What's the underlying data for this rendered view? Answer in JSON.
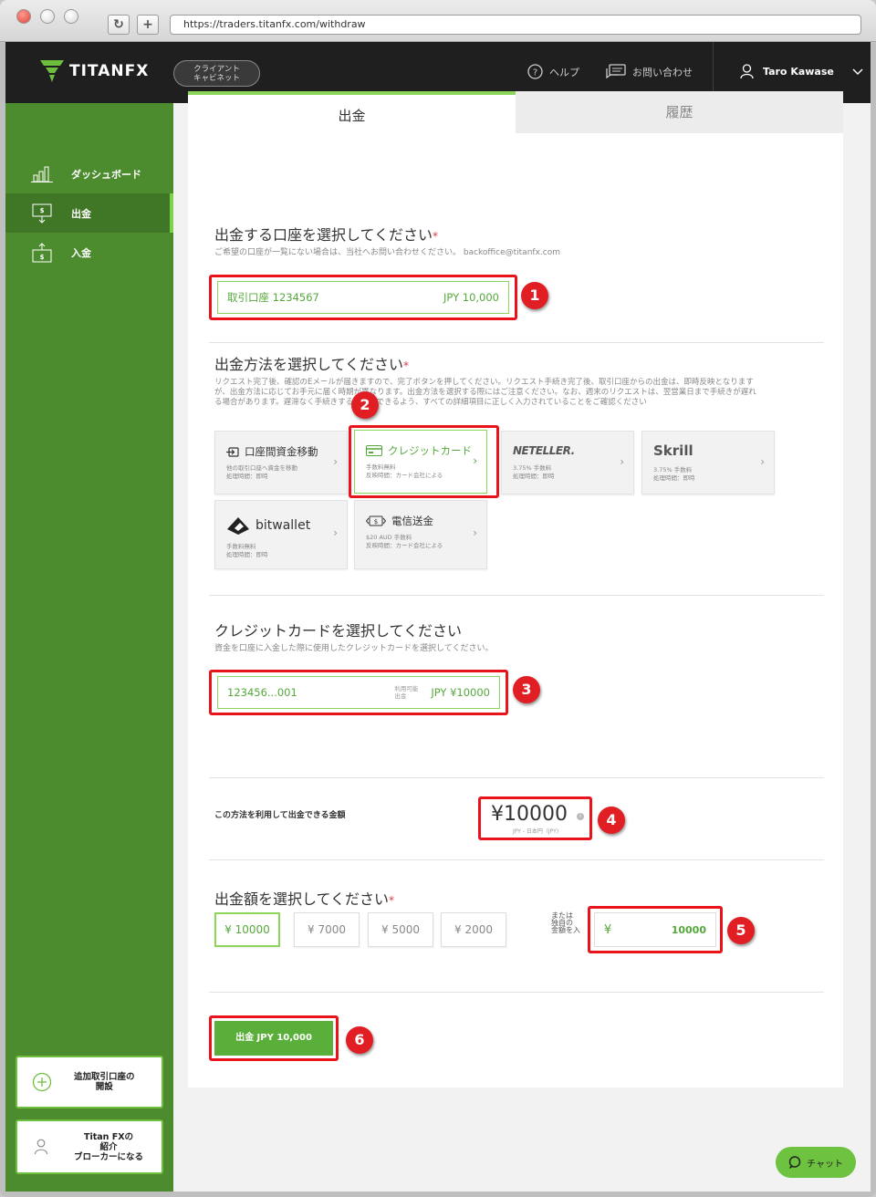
{
  "browser": {
    "url": "https://traders.titanfx.com/withdraw",
    "reload_icon": "reload-icon",
    "new_tab_label": "+"
  },
  "topbar": {
    "logo_text": "TITANFX",
    "cabinet_line1": "クライアント",
    "cabinet_line2": "キャビネット",
    "help_label": "ヘルプ",
    "contact_label": "お問い合わせ",
    "user_name": "Taro Kawase"
  },
  "sidebar": {
    "items": [
      {
        "label": "ダッシュボード",
        "icon": "bar-chart-icon"
      },
      {
        "label": "出金",
        "icon": "withdraw-icon"
      },
      {
        "label": "入金",
        "icon": "deposit-icon"
      }
    ],
    "add_account_line1": "追加取引口座の",
    "add_account_line2": "開設",
    "ib_line1": "Titan FXの",
    "ib_line2": "紹介",
    "ib_line3": "ブローカーになる"
  },
  "tabs": {
    "withdraw": "出金",
    "history": "履歴"
  },
  "account_section": {
    "title": "出金する口座を選択してください",
    "required": "*",
    "note": "ご希望の口座が一覧にない場合は、当社へお問い合わせください。 backoffice@titanfx.com",
    "account_name": "取引口座 1234567",
    "account_balance": "JPY 10,000"
  },
  "method_section": {
    "title": "出金方法を選択してください",
    "required": "*",
    "note_line1": "リクエスト完了後、確認のEメールが届きますので、完了ボタンを押してください。リクエスト手続き完了後、取引口座からの出金は、即時反映となります",
    "note_line2": "が、出金方法に応じてお手元に届く時期が異なります。出金方法を選択する際にはご注意ください。なお、週末のリクエストは、翌営業日まで手続きが遅れ",
    "note_line3": "る場合があります。遅滞なく手続きすることができるよう、すべての詳細項目に正しく入力されていることをご確認ください",
    "methods": [
      {
        "name": "口座間資金移動",
        "sub1": "他の取引口座へ資金を移動",
        "sub2": "処理時間：即時"
      },
      {
        "name": "クレジットカード",
        "sub1": "手数料無料",
        "sub2": "反映時間：カード会社による"
      },
      {
        "name": "NETELLER.",
        "sub1": "3.75% 手数料",
        "sub2": "処理時間：即時"
      },
      {
        "name": "Skrill",
        "sub1": "3.75% 手数料",
        "sub2": "処理時間：即時"
      },
      {
        "name": "bitwallet",
        "sub1": "手数料無料",
        "sub2": "処理時間：即時"
      },
      {
        "name": "電信送金",
        "sub1": "$20 AUD 手数料",
        "sub2": "反映時間：カード会社による"
      }
    ]
  },
  "card_section": {
    "title": "クレジットカードを選択してください",
    "note": "資金を口座に入金した際に使用したクレジットカードを選択してください。",
    "card_number": "123456...001",
    "available_line1": "利用可能",
    "available_line2": "出金",
    "card_amount": "JPY ¥10000"
  },
  "available_section": {
    "label": "この方法を利用して出金できる金額",
    "amount": "¥10000",
    "currency_note": "JPY - 日本円（JPY)"
  },
  "amount_section": {
    "title": "出金額を選択してください",
    "required": "*",
    "presets": [
      "¥ 10000",
      "¥ 7000",
      "¥ 5000",
      "¥ 2000"
    ],
    "custom_label_line1": "または",
    "custom_label_line2": "独自の",
    "custom_label_line3": "金額を入",
    "custom_currency": "¥",
    "custom_value": "10000"
  },
  "submit_label": "出金 JPY 10,000",
  "chat_label": "チャット",
  "annotations": [
    "1",
    "2",
    "3",
    "4",
    "5",
    "6"
  ],
  "colors": {
    "brand_green": "#4c8c2e",
    "accent_green": "#8cd65c",
    "highlight_red": "#e8131b",
    "topbar": "#1f1f1f"
  }
}
